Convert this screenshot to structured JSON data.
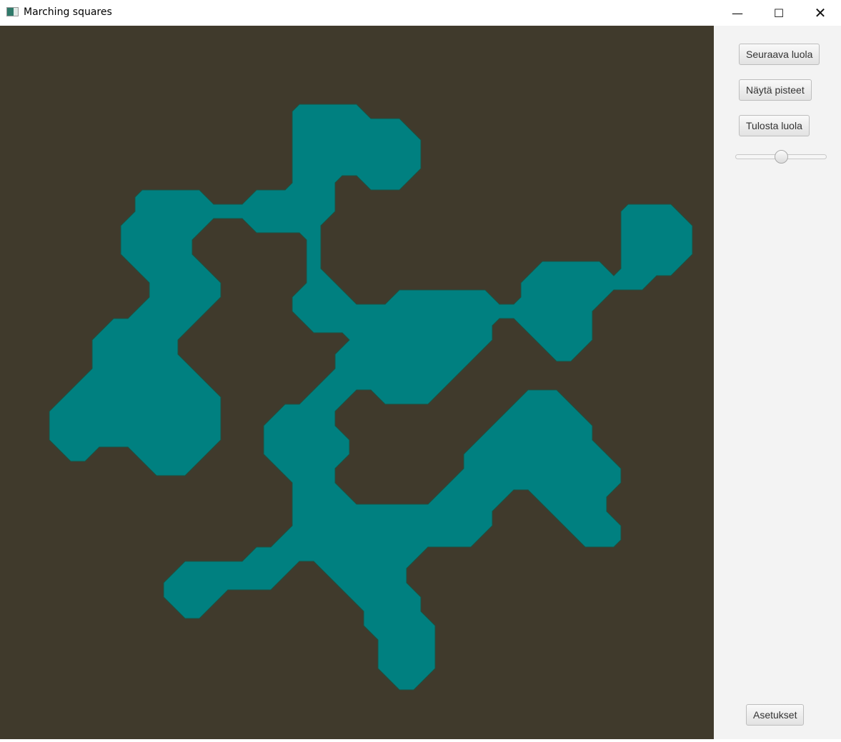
{
  "window": {
    "title": "Marching squares",
    "minimize_icon": "minimize-icon",
    "maximize_icon": "maximize-icon",
    "close_icon": "close-icon"
  },
  "colors": {
    "background": "#403a2c",
    "cave": "#008080",
    "panel": "#f3f3f3"
  },
  "side_panel": {
    "next_cave_label": "Seuraava luola",
    "show_points_label": "Näytä pisteet",
    "print_cave_label": "Tulosta luola",
    "slider_value_percent": 50,
    "settings_label": "Asetukset"
  }
}
